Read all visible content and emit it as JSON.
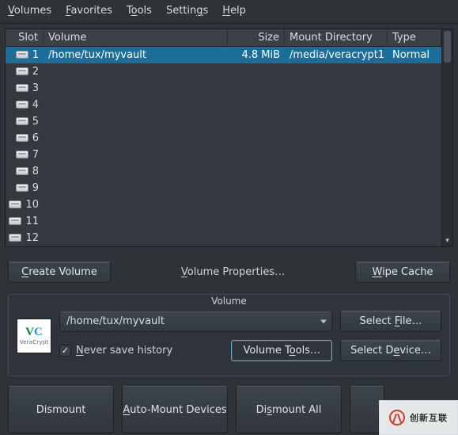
{
  "menu": {
    "volumes": "Volumes",
    "favorites": "Favorites",
    "tools": "Tools",
    "settings": "Settings",
    "help": "Help"
  },
  "columns": {
    "slot": "Slot",
    "volume": "Volume",
    "size": "Size",
    "mount": "Mount Directory",
    "type": "Type"
  },
  "slots": {
    "r1": {
      "n": "1",
      "volume": "/home/tux/myvault",
      "size": "4.8 MiB",
      "mount": "/media/veracrypt1",
      "type": "Normal"
    },
    "r2": {
      "n": "2"
    },
    "r3": {
      "n": "3"
    },
    "r4": {
      "n": "4"
    },
    "r5": {
      "n": "5"
    },
    "r6": {
      "n": "6"
    },
    "r7": {
      "n": "7"
    },
    "r8": {
      "n": "8"
    },
    "r9": {
      "n": "9"
    },
    "r10": {
      "n": "10"
    },
    "r11": {
      "n": "11"
    },
    "r12": {
      "n": "12"
    }
  },
  "buttons": {
    "create": "Create Volume",
    "props": "Volume Properties…",
    "wipe": "Wipe Cache",
    "select_file": "Select File…",
    "select_device": "Select Device…",
    "volume_tools": "Volume Tools…",
    "dismount": "Dismount",
    "automount": "Auto-Mount Devices",
    "dismount_all": "Dismount All"
  },
  "group": {
    "title": "Volume",
    "path": "/home/tux/myvault",
    "never_save": "Never save history",
    "logo_brand": "VeraCrypt"
  },
  "watermark": "创新互联"
}
